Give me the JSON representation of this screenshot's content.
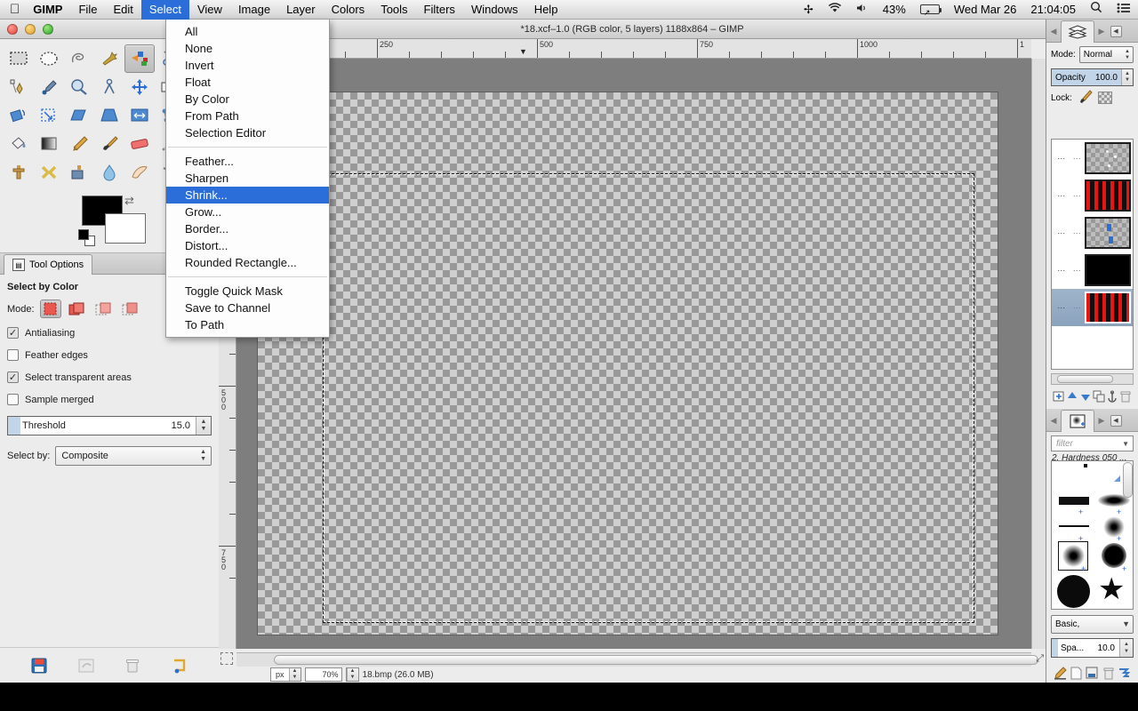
{
  "macbar": {
    "apple_icon": "apple-logo",
    "app_name": "GIMP",
    "items": [
      "File",
      "Edit",
      "Select",
      "View",
      "Image",
      "Layer",
      "Colors",
      "Tools",
      "Filters",
      "Windows",
      "Help"
    ],
    "active_item": "Select",
    "status": {
      "bluetooth_icon": "bluetooth-icon",
      "wifi_icon": "wifi-icon",
      "volume_icon": "volume-icon",
      "battery_percent": "43%",
      "battery_icon": "battery-icon",
      "date": "Wed Mar 26",
      "time": "21:04:05",
      "search_icon": "search-icon",
      "list_icon": "control-center-icon"
    }
  },
  "select_menu": {
    "groups": [
      [
        "All",
        "None",
        "Invert",
        "Float",
        "By Color",
        "From Path",
        "Selection Editor"
      ],
      [
        "Feather...",
        "Sharpen",
        "Shrink...",
        "Grow...",
        "Border...",
        "Distort...",
        "Rounded Rectangle..."
      ],
      [
        "Toggle Quick Mask",
        "Save to Channel",
        "To Path"
      ]
    ],
    "highlighted": "Shrink..."
  },
  "toolbox": {
    "window_title": "",
    "tools": [
      {
        "name": "rect-select-tool",
        "glyph": "▭"
      },
      {
        "name": "ellipse-select-tool",
        "glyph": "◯"
      },
      {
        "name": "free-select-tool",
        "glyph": "✑"
      },
      {
        "name": "fuzzy-select-tool",
        "glyph": "✦"
      },
      {
        "name": "select-by-color-tool",
        "glyph": "▤",
        "selected": true
      },
      {
        "name": "scissors-select-tool",
        "glyph": "✂"
      },
      {
        "name": "foreground-select-tool",
        "glyph": "◑"
      },
      {
        "name": "paths-tool",
        "glyph": "✒"
      },
      {
        "name": "color-picker-tool",
        "glyph": "💧"
      },
      {
        "name": "zoom-tool",
        "glyph": "🔍"
      },
      {
        "name": "measure-tool",
        "glyph": "📐"
      },
      {
        "name": "move-tool",
        "glyph": "✥"
      },
      {
        "name": "alignment-tool",
        "glyph": "▤"
      },
      {
        "name": "crop-tool",
        "glyph": "⊞"
      },
      {
        "name": "rotate-tool",
        "glyph": "⟳"
      },
      {
        "name": "scale-tool",
        "glyph": "⤢"
      },
      {
        "name": "shear-tool",
        "glyph": "▱"
      },
      {
        "name": "perspective-tool",
        "glyph": "▣"
      },
      {
        "name": "flip-tool",
        "glyph": "⇔"
      },
      {
        "name": "cage-transform-tool",
        "glyph": "⬡"
      },
      {
        "name": "text-tool",
        "glyph": "A"
      },
      {
        "name": "bucket-fill-tool",
        "glyph": "⛽"
      },
      {
        "name": "blend-tool",
        "glyph": "▦"
      },
      {
        "name": "pencil-tool",
        "glyph": "✏"
      },
      {
        "name": "paintbrush-tool",
        "glyph": "🖌"
      },
      {
        "name": "eraser-tool",
        "glyph": "▬"
      },
      {
        "name": "airbrush-tool",
        "glyph": "✈"
      },
      {
        "name": "ink-tool",
        "glyph": "✍"
      },
      {
        "name": "clone-tool",
        "glyph": "⚗"
      },
      {
        "name": "heal-tool",
        "glyph": "✚"
      },
      {
        "name": "perspective-clone-tool",
        "glyph": "⧉"
      },
      {
        "name": "blur-sharpen-tool",
        "glyph": "💧"
      },
      {
        "name": "smudge-tool",
        "glyph": "☍"
      },
      {
        "name": "dodge-burn-tool",
        "glyph": "●"
      }
    ],
    "foreground_color": "#000000",
    "background_color": "#ffffff",
    "swap_icon": "swap-colors-icon",
    "reset_icon": "reset-colors-icon",
    "footer_icons": [
      {
        "name": "save-device-status-icon",
        "glyph": "💾"
      },
      {
        "name": "restore-tool-preset-icon",
        "glyph": "🗔"
      },
      {
        "name": "delete-tool-preset-icon",
        "glyph": "🗑"
      },
      {
        "name": "reset-tool-options-icon",
        "glyph": "↺"
      }
    ]
  },
  "tool_options": {
    "tab_label": "Tool Options",
    "tab_icon": "tool-options-icon",
    "title": "Select by Color",
    "mode_label": "Mode:",
    "modes": [
      {
        "name": "mode-replace",
        "selected": true
      },
      {
        "name": "mode-add",
        "selected": false
      },
      {
        "name": "mode-subtract",
        "selected": false
      },
      {
        "name": "mode-intersect",
        "selected": false
      }
    ],
    "checkboxes": [
      {
        "label": "Antialiasing",
        "checked": true
      },
      {
        "label": "Feather edges",
        "checked": false
      },
      {
        "label": "Select transparent areas",
        "checked": true
      },
      {
        "label": "Sample merged",
        "checked": false
      }
    ],
    "threshold": {
      "label": "Threshold",
      "value": "15.0"
    },
    "select_by": {
      "label": "Select by:",
      "value": "Composite"
    }
  },
  "image_window": {
    "title": "*18.xcf–1.0 (RGB color, 5 layers) 1188x864 – GIMP",
    "h_ruler_labels": [
      "250",
      "500",
      "750",
      "1000",
      "1"
    ],
    "v_ruler_labels": [
      "500",
      "750"
    ],
    "status": {
      "unit": "px",
      "zoom": "70%",
      "file_info": "18.bmp (26.0 MB)"
    },
    "quick_mask_icon": "quick-mask-toggle-icon",
    "navigate_icon": "navigate-canvas-icon"
  },
  "layers_dock": {
    "tab_icon": "layers-tab-icon",
    "menu_icon": "dock-menu-icon",
    "prev_icon": "tab-prev-icon",
    "next_icon": "tab-next-icon",
    "mode_label": "Mode:",
    "mode_value": "Normal",
    "opacity_label": "Opacity",
    "opacity_value": "100.0",
    "lock_label": "Lock:",
    "lock_pixels_icon": "lock-pixels-icon",
    "lock_alpha_icon": "lock-alpha-icon",
    "layers": [
      {
        "name": "layer-1",
        "kind": "checker-dots",
        "selected": false
      },
      {
        "name": "layer-2",
        "kind": "stripes",
        "selected": false
      },
      {
        "name": "layer-3",
        "kind": "checker-blues",
        "selected": false
      },
      {
        "name": "layer-4",
        "kind": "solid-black",
        "selected": false
      },
      {
        "name": "layer-5",
        "kind": "stripes",
        "selected": true
      }
    ],
    "footer_icons": [
      {
        "name": "new-layer-icon",
        "glyph": "▤"
      },
      {
        "name": "raise-layer-icon",
        "glyph": "▲"
      },
      {
        "name": "lower-layer-icon",
        "glyph": "▼"
      },
      {
        "name": "duplicate-layer-icon",
        "glyph": "⧉"
      },
      {
        "name": "anchor-layer-icon",
        "glyph": "⚓"
      },
      {
        "name": "delete-layer-icon",
        "glyph": "🗑"
      }
    ]
  },
  "brushes_dock": {
    "tab_icon": "brushes-tab-icon",
    "filter_placeholder": "filter",
    "filter_value": "",
    "brush_name": "2. Hardness 050 ...",
    "preset_value": "Basic,",
    "spacing_label": "Spa...",
    "spacing_value": "10.0",
    "footer_icons": [
      {
        "name": "edit-brush-icon",
        "glyph": "✎"
      },
      {
        "name": "new-brush-icon",
        "glyph": "🗋"
      },
      {
        "name": "duplicate-brush-icon",
        "glyph": "⧉"
      },
      {
        "name": "delete-brush-icon",
        "glyph": "🗑"
      },
      {
        "name": "refresh-brushes-icon",
        "glyph": "↻"
      }
    ]
  }
}
